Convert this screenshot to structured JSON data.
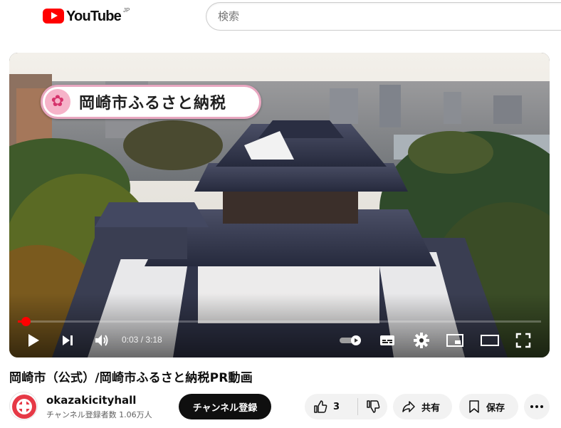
{
  "header": {
    "logo_text": "YouTube",
    "region_label": "JP",
    "search_placeholder": "検索"
  },
  "player": {
    "overlay_title": "岡崎市ふるさと納税",
    "current_time": "0:03",
    "duration": "3:18",
    "time_display": "0:03 / 3:18",
    "progress_fraction": 0.015,
    "accent_color": "#ff0000",
    "controls": [
      "play-icon",
      "next-icon",
      "volume-icon",
      "autoplay-toggle",
      "subtitles-icon",
      "settings-icon",
      "miniplayer-icon",
      "theater-icon",
      "fullscreen-icon"
    ]
  },
  "video": {
    "title": "岡崎市（公式）/岡崎市ふるさと納税PR動画"
  },
  "channel": {
    "name": "okazakicityhall",
    "subscribers": "チャンネル登録者数 1.06万人",
    "subscribe_label": "チャンネル登録"
  },
  "actions": {
    "like_count": "3",
    "share_label": "共有",
    "save_label": "保存"
  }
}
